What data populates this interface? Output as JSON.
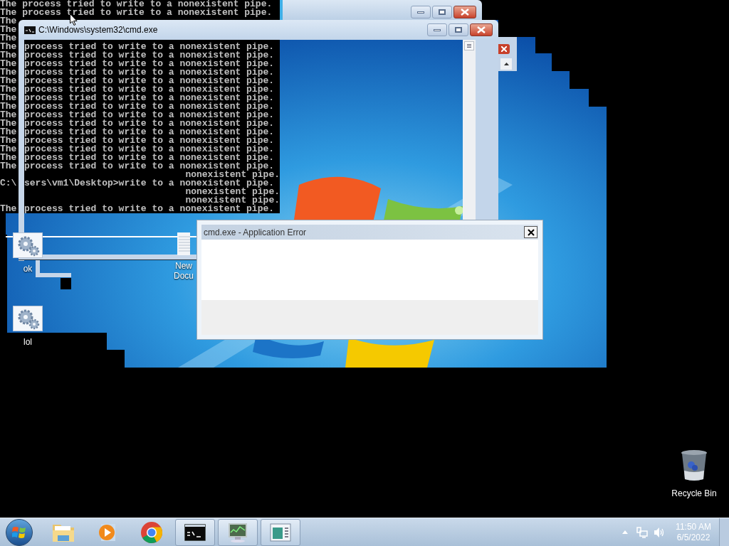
{
  "console_lines": [
    {
      "kind": "full",
      "text": "The process tried to write to a nonexistent pipe."
    },
    {
      "kind": "full",
      "text": "The process tried to write to a nonexistent pipe."
    },
    {
      "kind": "stub",
      "left": "The"
    },
    {
      "kind": "stub",
      "left": "The"
    },
    {
      "kind": "stub",
      "left": "The"
    },
    {
      "kind": "split",
      "left": "The",
      "text": "process tried to write to a nonexistent pipe."
    },
    {
      "kind": "split",
      "left": "The",
      "text": "process tried to write to a nonexistent pipe."
    },
    {
      "kind": "split",
      "left": "The",
      "text": "process tried to write to a nonexistent pipe."
    },
    {
      "kind": "split",
      "left": "The",
      "text": "process tried to write to a nonexistent pipe."
    },
    {
      "kind": "split",
      "left": "The",
      "text": "process tried to write to a nonexistent pipe."
    },
    {
      "kind": "split",
      "left": "The",
      "text": "process tried to write to a nonexistent pipe."
    },
    {
      "kind": "split",
      "left": "The",
      "text": "process tried to write to a nonexistent pipe."
    },
    {
      "kind": "split",
      "left": "The",
      "text": "process tried to write to a nonexistent pipe."
    },
    {
      "kind": "split",
      "left": "The",
      "text": "process tried to write to a nonexistent pipe."
    },
    {
      "kind": "split",
      "left": "The",
      "text": "process tried to write to a nonexistent pipe."
    },
    {
      "kind": "split",
      "left": "The",
      "text": "process tried to write to a nonexistent pipe."
    },
    {
      "kind": "split",
      "left": "The",
      "text": "process tried to write to a nonexistent pipe."
    },
    {
      "kind": "split",
      "left": "The",
      "text": "process tried to write to a nonexistent pipe."
    },
    {
      "kind": "split",
      "left": "The",
      "text": "process tried to write to a nonexistent pipe."
    },
    {
      "kind": "split",
      "left": "The",
      "text": "process tried to write to a nonexistent pipe."
    },
    {
      "kind": "tail",
      "text": "nonexistent pipe."
    },
    {
      "kind": "split",
      "left": "C:\\",
      "text": "sers\\vm1\\Desktop>write to a nonexistent pipe."
    },
    {
      "kind": "tail",
      "text": "nonexistent pipe."
    },
    {
      "kind": "tail",
      "text": "nonexistent pipe."
    },
    {
      "kind": "split",
      "left": "The",
      "text": "process tried to write to a nonexistent pipe."
    }
  ],
  "cmd_window": {
    "title": "C:\\Windows\\system32\\cmd.exe"
  },
  "desktop_icons": [
    {
      "kind": "gear",
      "label": "ok"
    },
    {
      "kind": "document",
      "label": "New Docu"
    },
    {
      "kind": "gear",
      "label": "lol"
    }
  ],
  "recycle_bin": {
    "label": "Recycle Bin"
  },
  "error_dialog": {
    "title": "cmd.exe - Application Error"
  },
  "taskbar": {
    "items": [
      {
        "kind": "folder",
        "running": false
      },
      {
        "kind": "media",
        "running": false
      },
      {
        "kind": "chrome",
        "running": false
      },
      {
        "kind": "console",
        "running": true
      },
      {
        "kind": "monitor",
        "running": true
      },
      {
        "kind": "window",
        "running": true
      }
    ],
    "clock": {
      "time": "11:50 AM",
      "date": "6/5/2022"
    }
  }
}
